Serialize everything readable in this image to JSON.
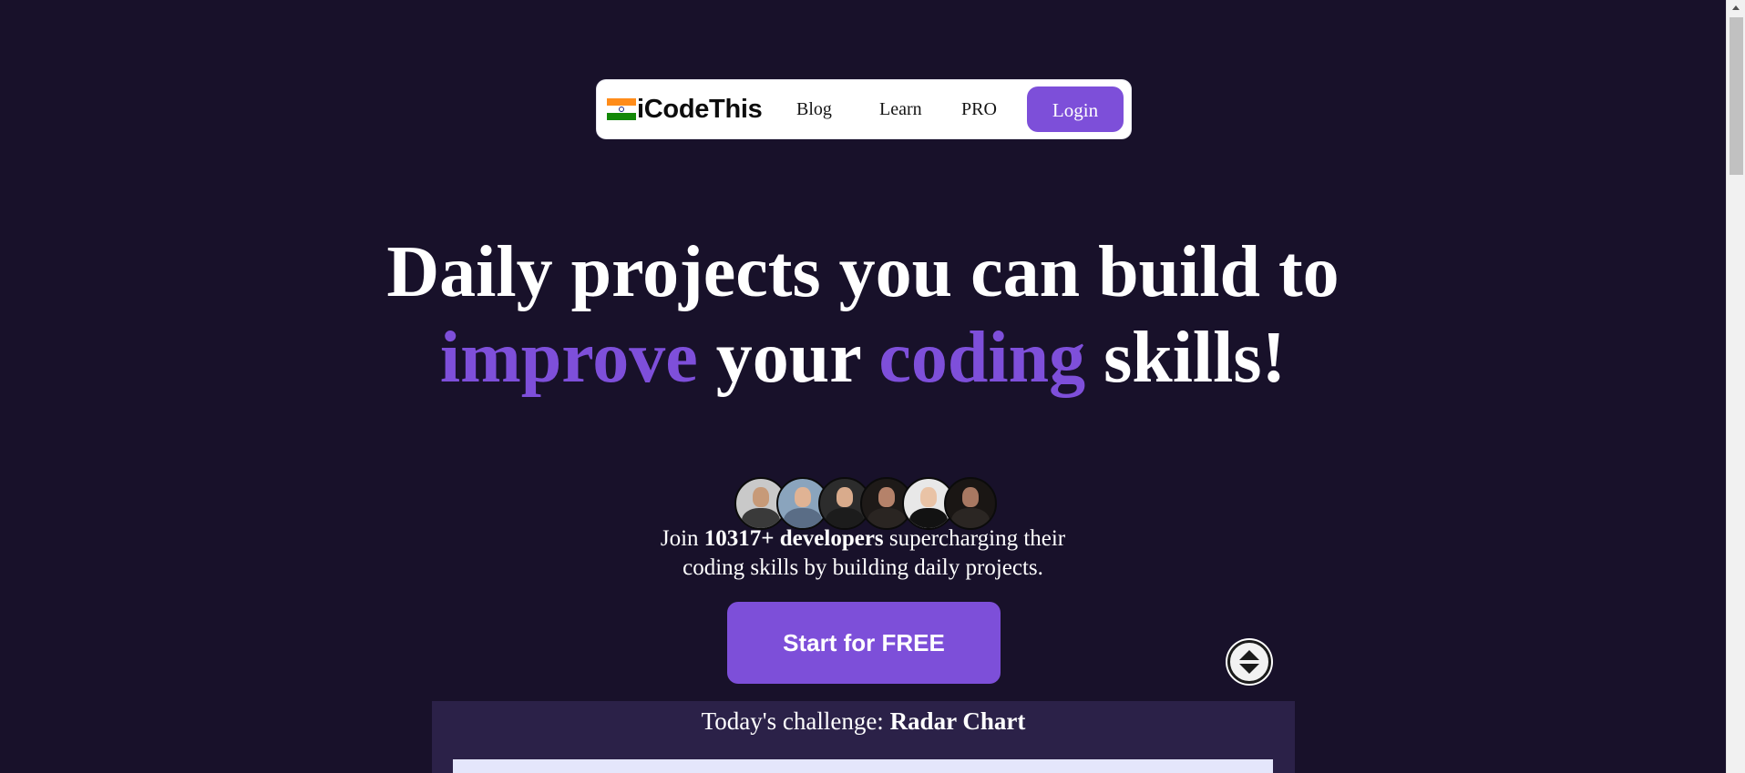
{
  "nav": {
    "logo_text": "iCodeThis",
    "links": [
      "Blog",
      "Learn",
      "PRO"
    ],
    "login_label": "Login"
  },
  "hero": {
    "line1": "Daily projects you can build to",
    "word_improve": "improve",
    "word_your": "your",
    "word_coding": "coding",
    "word_skills": "skills!"
  },
  "join": {
    "prefix": "Join",
    "count": "10317+ developers",
    "line1_suffix": "supercharging their",
    "line2": "coding skills by building daily projects."
  },
  "cta_label": "Start for FREE",
  "challenge": {
    "prefix": "Today's challenge:",
    "name": "Radar Chart"
  },
  "avatars": [
    {
      "icon": "person-avatar-1",
      "bg": "#c9c9c9",
      "skin": "#c79a78",
      "shirt": "#3a3a3a"
    },
    {
      "icon": "person-avatar-2",
      "bg": "#8aa4bd",
      "skin": "#e0b394",
      "shirt": "#5a6d86"
    },
    {
      "icon": "person-avatar-3",
      "bg": "#2c2c2c",
      "skin": "#d9ab8c",
      "shirt": "#1c1c1c"
    },
    {
      "icon": "person-avatar-4",
      "bg": "#1e1a18",
      "skin": "#b5826a",
      "shirt": "#2a2522"
    },
    {
      "icon": "person-avatar-5",
      "bg": "#e8e8e8",
      "skin": "#e9c3a6",
      "shirt": "#121212"
    },
    {
      "icon": "person-avatar-6",
      "bg": "#1a1614",
      "skin": "#a87862",
      "shirt": "#2b2623"
    }
  ],
  "colors": {
    "background": "#18112a",
    "accent": "#7d4fd9",
    "card": "#2b2148"
  }
}
